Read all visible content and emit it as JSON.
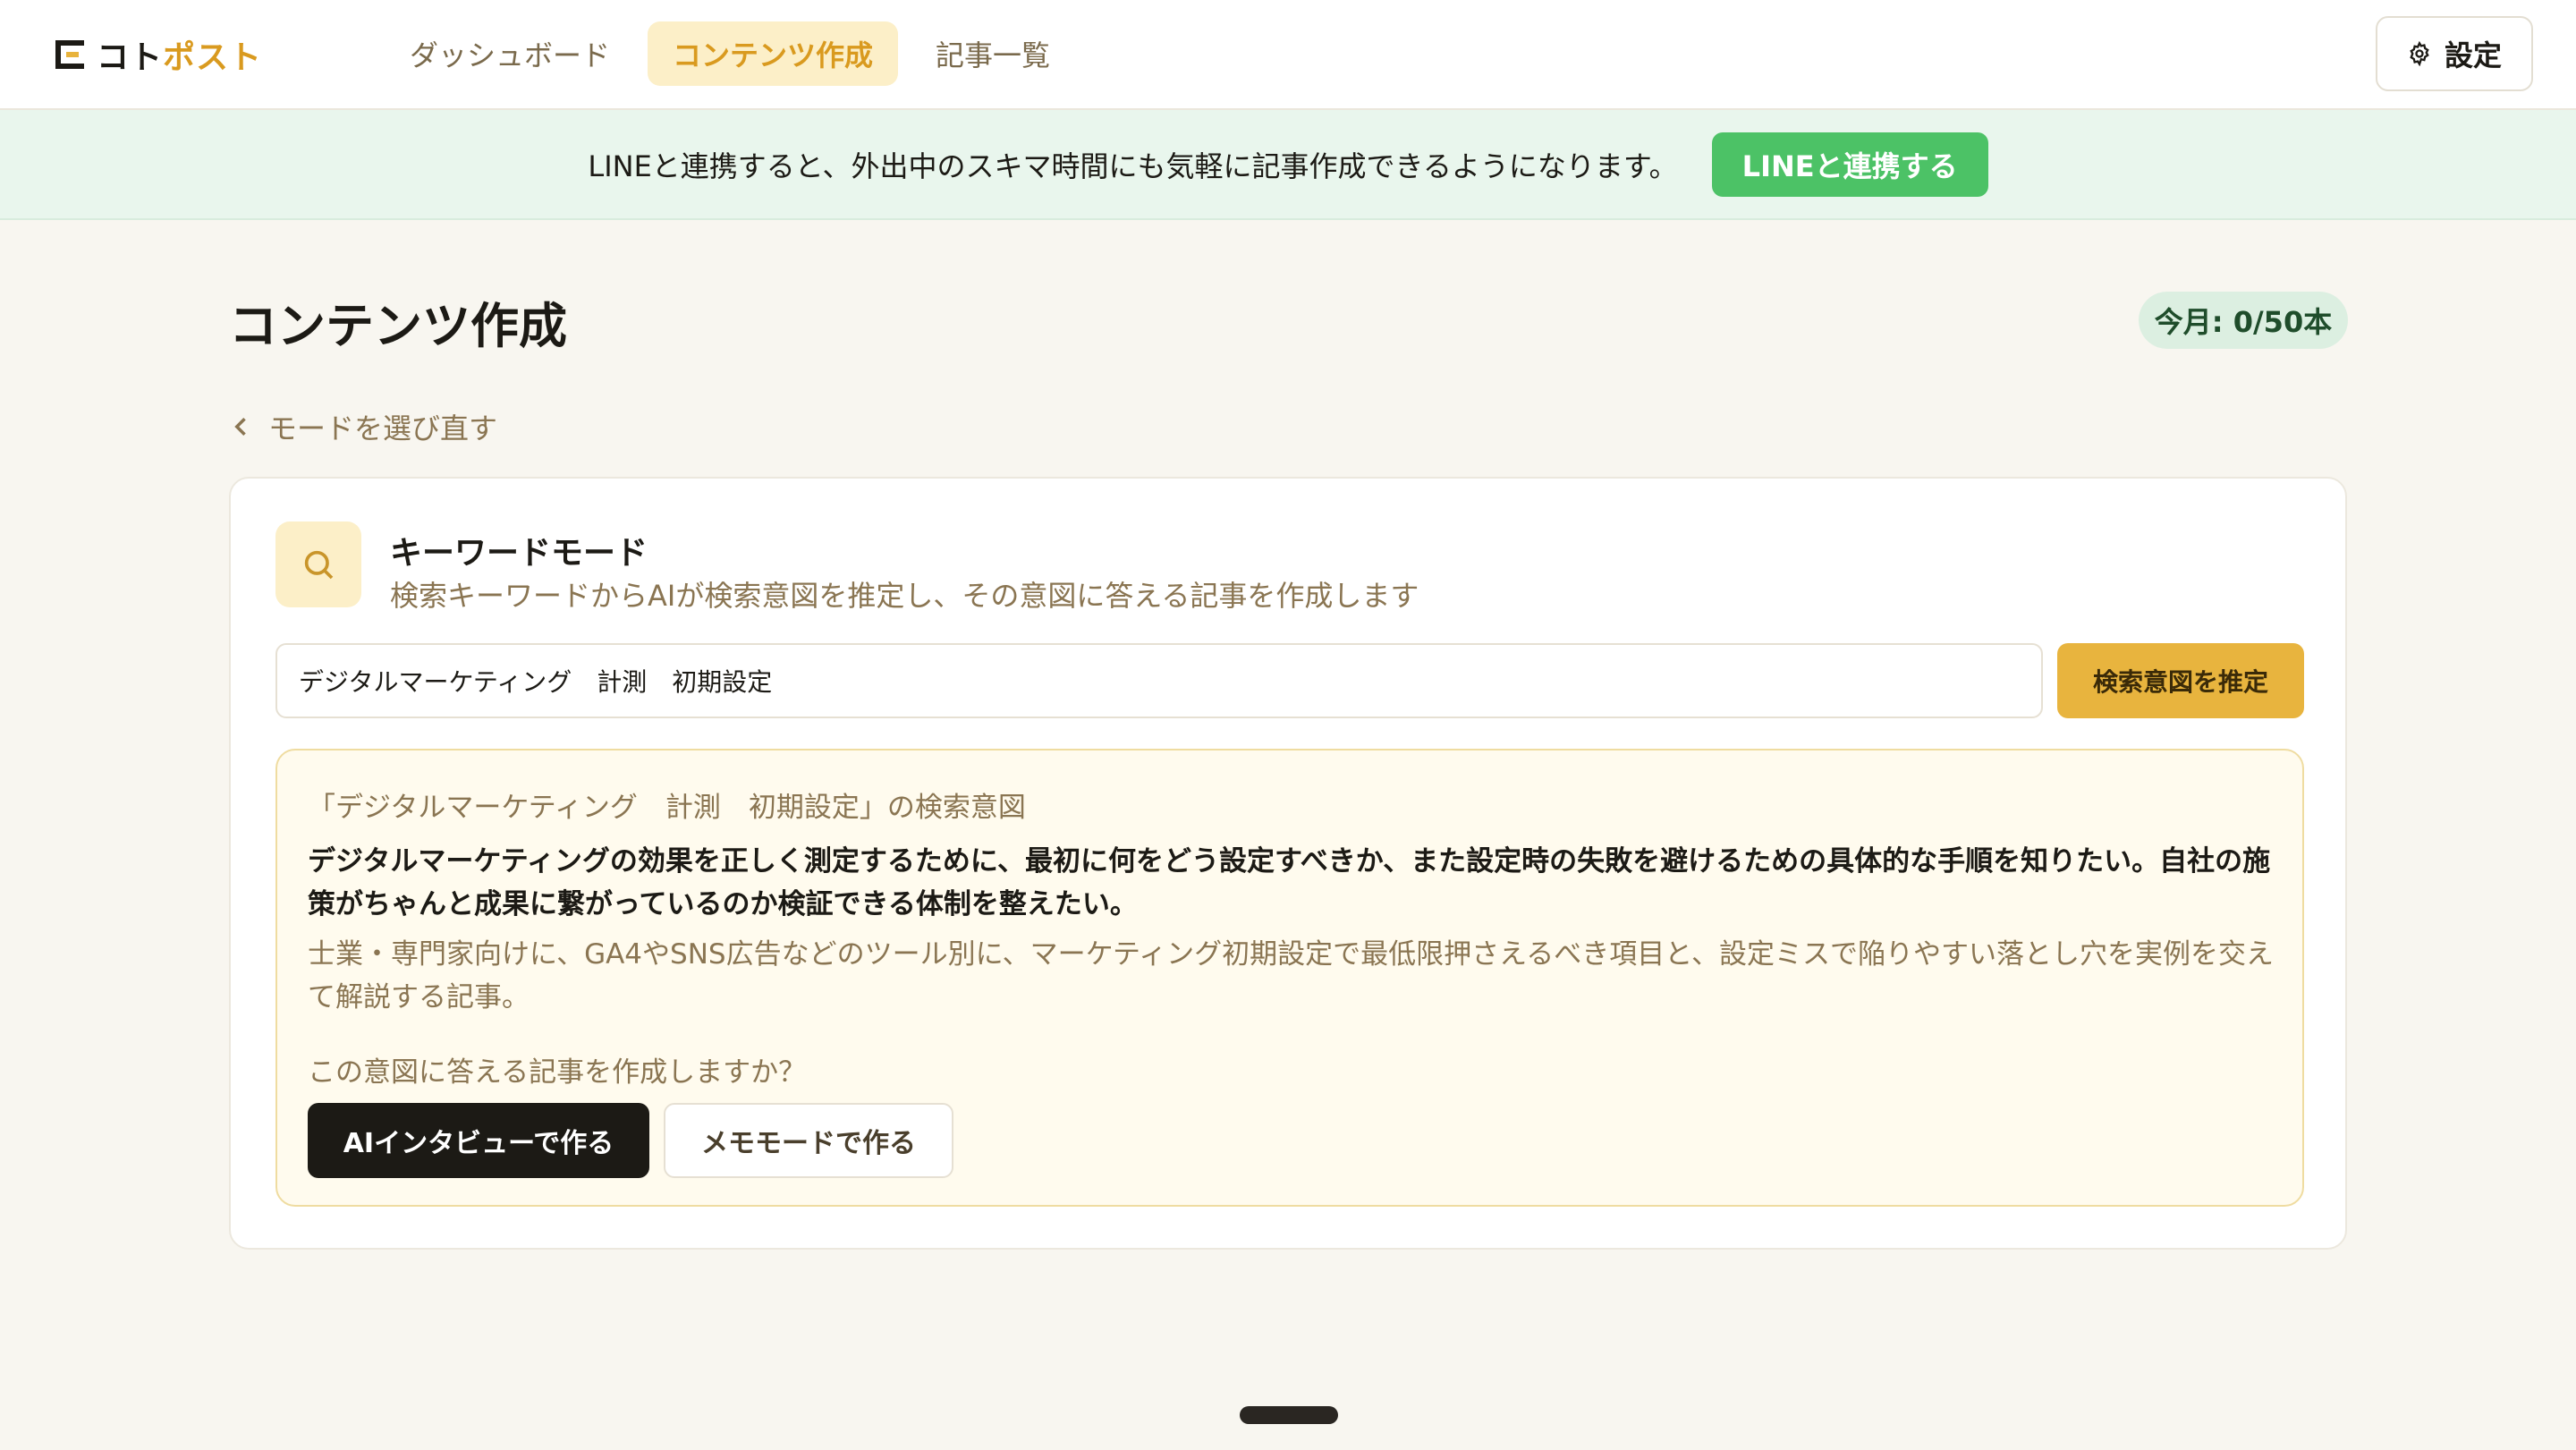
{
  "header": {
    "logo": {
      "part1": "コト",
      "part2": "ポスト"
    },
    "nav": [
      {
        "label": "ダッシュボード",
        "active": false
      },
      {
        "label": "コンテンツ作成",
        "active": true
      },
      {
        "label": "記事一覧",
        "active": false
      }
    ],
    "settings_label": "設定"
  },
  "banner": {
    "text": "LINEと連携すると、外出中のスキマ時間にも気軽に記事作成できるようになります。",
    "button_label": "LINEと連携する"
  },
  "page": {
    "title": "コンテンツ作成",
    "quota": "今月: 0/50本",
    "back_label": "モードを選び直す"
  },
  "mode": {
    "title": "キーワードモード",
    "description": "検索キーワードからAIが検索意図を推定し、その意図に答える記事を作成します",
    "keyword_value": "デジタルマーケティング　計測　初期設定",
    "estimate_button": "検索意図を推定"
  },
  "intent": {
    "title": "「デジタルマーケティング　計測　初期設定」の検索意図",
    "main": "デジタルマーケティングの効果を正しく測定するために、最初に何をどう設定すべきか、また設定時の失敗を避けるための具体的な手順を知りたい。自社の施策がちゃんと成果に繋がっているのか検証できる体制を整えたい。",
    "sub": "士業・専門家向けに、GA4やSNS広告などのツール別に、マーケティング初期設定で最低限押さえるべき項目と、設定ミスで陥りやすい落とし穴を実例を交えて解説する記事。",
    "question": "この意図に答える記事を作成しますか？",
    "ai_button": "AIインタビューで作る",
    "memo_button": "メモモードで作る"
  },
  "colors": {
    "accent": "#e8b43e",
    "line_green": "#4cc266",
    "dark": "#1c1a15"
  }
}
